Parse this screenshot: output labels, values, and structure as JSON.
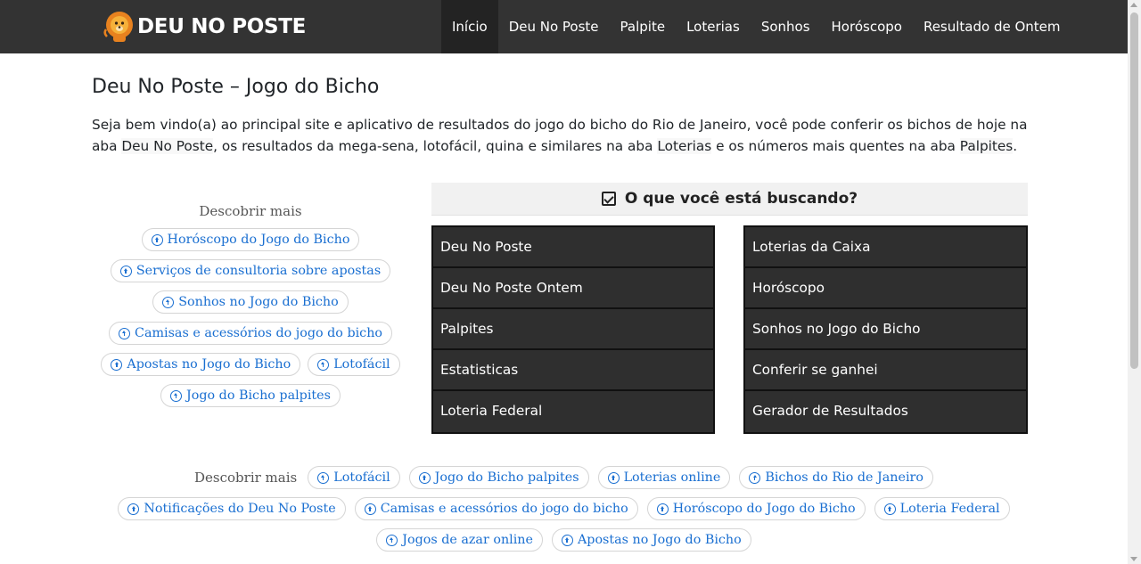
{
  "header": {
    "logo_text": "DEU NO POSTE",
    "nav": [
      "Início",
      "Deu No Poste",
      "Palpite",
      "Loterias",
      "Sonhos",
      "Horóscopo",
      "Resultado de Ontem"
    ],
    "active_index": 0
  },
  "main": {
    "title": "Deu No Poste – Jogo do Bicho",
    "intro": {
      "part1": "Seja bem vindo(a) ao principal site e aplicativo de resultados do jogo do bicho do Rio de Janeiro, você pode conferir os bichos de hoje na aba ",
      "link1": "Deu No Poste",
      "part2": ", os resultados da mega-sena, lotofácil, quina e similares na aba ",
      "link2": "Loterias",
      "part3": " e os números mais quentes na aba ",
      "link3": "Palpites",
      "part4": "."
    }
  },
  "discover_left": {
    "title": "Descobrir mais",
    "rows": [
      [
        "Horóscopo do Jogo do Bicho"
      ],
      [
        "Serviços de consultoria sobre apostas"
      ],
      [
        "Sonhos no Jogo do Bicho"
      ],
      [
        "Camisas e acessórios do jogo do bicho"
      ],
      [
        "Apostas no Jogo do Bicho",
        "Lotofácil"
      ],
      [
        "Jogo do Bicho palpites"
      ]
    ]
  },
  "search": {
    "title": "O que você está buscando?",
    "left_items": [
      "Deu No Poste",
      "Deu No Poste Ontem",
      "Palpites",
      "Estatisticas",
      "Loteria Federal"
    ],
    "right_items": [
      "Loterias da Caixa",
      "Horóscopo",
      "Sonhos no Jogo do Bicho",
      "Conferir se ganhei",
      "Gerador de Resultados"
    ]
  },
  "discover_bottom": {
    "title": "Descobrir mais",
    "rows": [
      [
        "Lotofácil",
        "Jogo do Bicho palpites",
        "Loterias online",
        "Bichos do Rio de Janeiro"
      ],
      [
        "Notificações do Deu No Poste",
        "Camisas e acessórios do jogo do bicho",
        "Horóscopo do Jogo do Bicho",
        "Loteria Federal"
      ],
      [
        "Jogos de azar online",
        "Apostas no Jogo do Bicho"
      ]
    ]
  },
  "colors": {
    "navbar": "#333333",
    "link": "#1a6fd1",
    "menu_bg": "#2f2f2f"
  },
  "icons": {
    "logo": "lion-mascot-icon",
    "tag": "circle-arrow-up-icon",
    "search": "checkbox-checked-icon"
  }
}
